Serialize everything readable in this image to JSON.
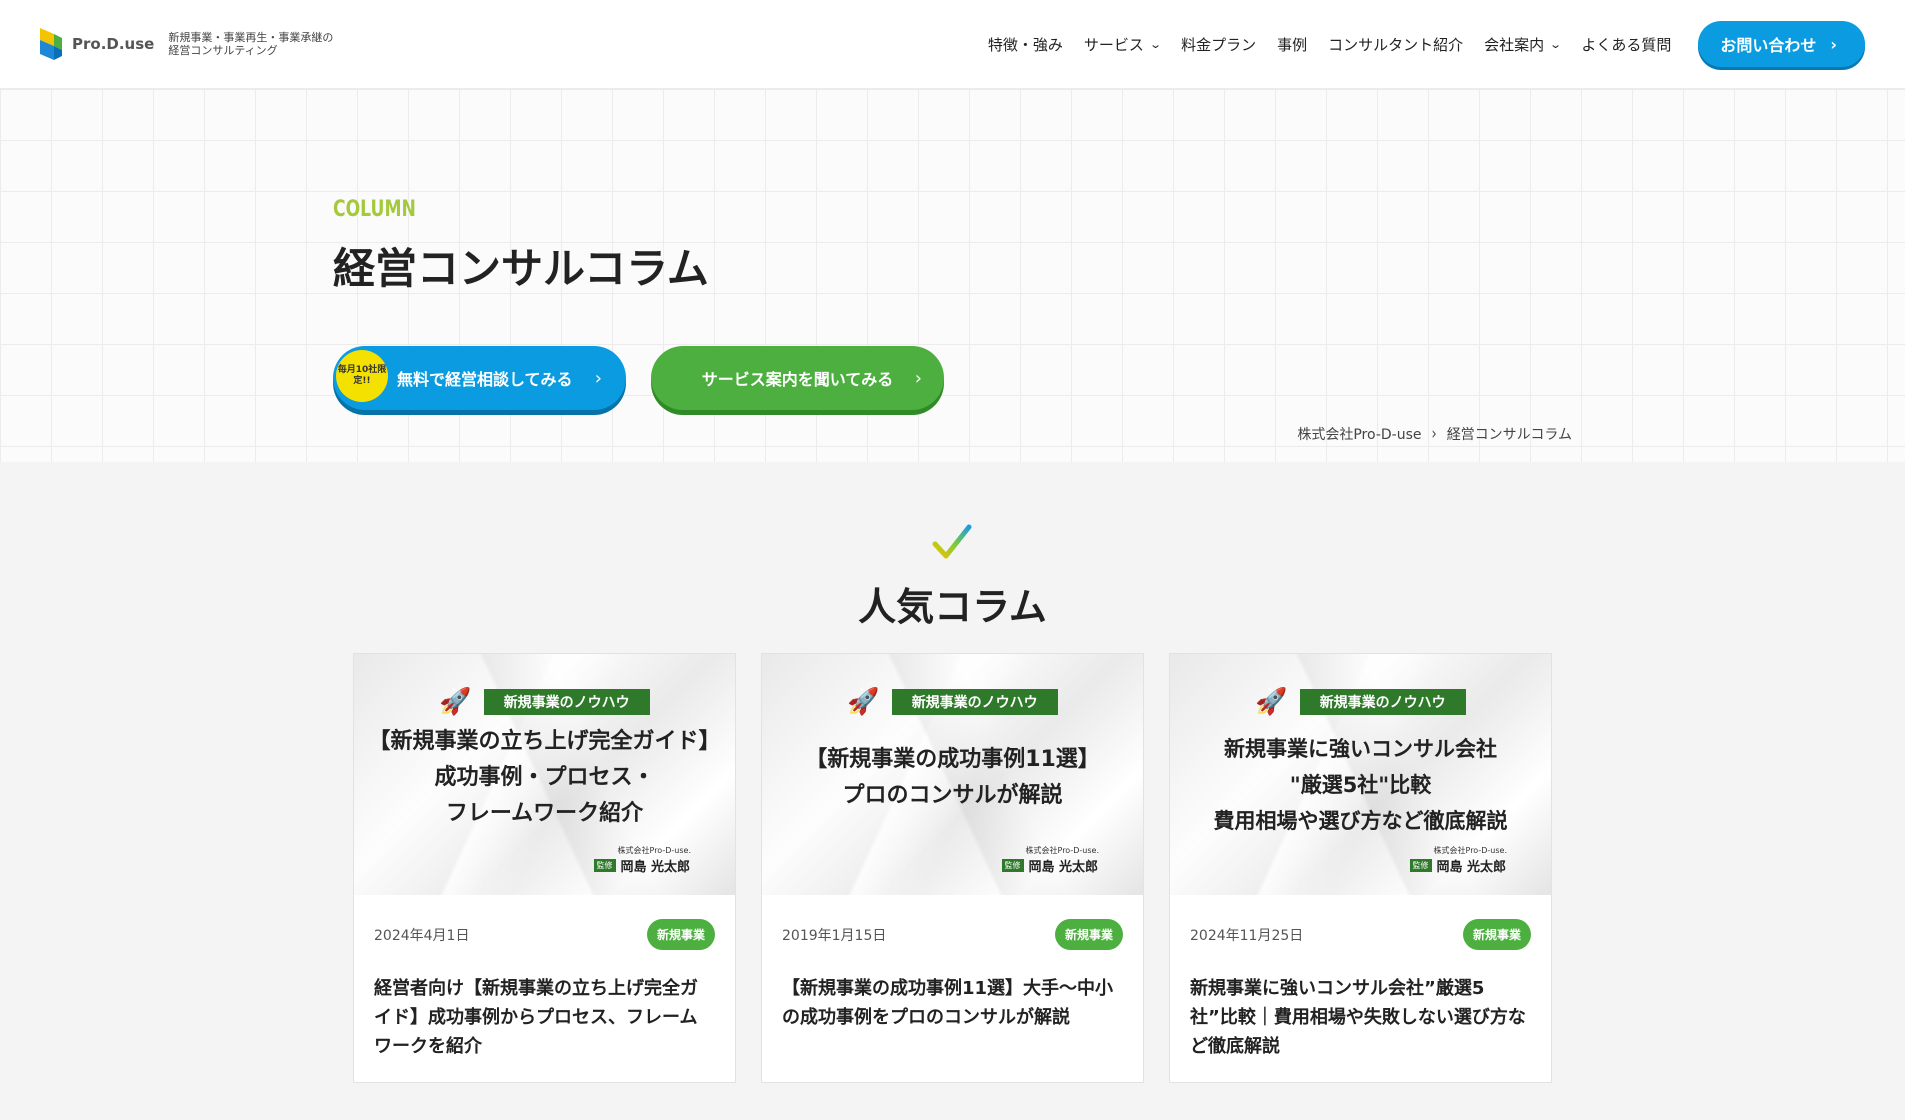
{
  "header": {
    "logo_word": "Pro.D.use",
    "tagline": "新規事業・事業再生・事業承継の経営コンサルティング",
    "nav": [
      {
        "label": "特徴・強み",
        "has_dropdown": false
      },
      {
        "label": "サービス",
        "has_dropdown": true
      },
      {
        "label": "料金プラン",
        "has_dropdown": false
      },
      {
        "label": "事例",
        "has_dropdown": false
      },
      {
        "label": "コンサルタント紹介",
        "has_dropdown": false
      },
      {
        "label": "会社案内",
        "has_dropdown": true
      },
      {
        "label": "よくある質問",
        "has_dropdown": false
      }
    ],
    "contact_label": "お問い合わせ"
  },
  "hero": {
    "eyebrow": "COLUMN",
    "title": "経営コンサルコラム",
    "cta_primary": {
      "badge": "毎月10社限定!!",
      "label": "無料で経営相談してみる"
    },
    "cta_secondary": {
      "label": "サービス案内を聞いてみる"
    },
    "breadcrumb": [
      "株式会社Pro-D-use",
      "経営コンサルコラム"
    ]
  },
  "popular": {
    "title": "人気コラム",
    "cards": [
      {
        "thumb_tag": "新規事業のノウハウ",
        "thumb_title": "【新規事業の立ち上げ完全ガイド】\n成功事例・プロセス・\nフレームワーク紹介",
        "supervisor_company": "株式会社Pro-D-use.",
        "supervisor_label": "監修",
        "supervisor_name": "岡島 光太郎",
        "date": "2024年4月1日",
        "category": "新規事業",
        "title": "経営者向け【新規事業の立ち上げ完全ガイド】成功事例からプロセス、フレームワークを紹介"
      },
      {
        "thumb_tag": "新規事業のノウハウ",
        "thumb_title": "【新規事業の成功事例11選】\nプロのコンサルが解説",
        "supervisor_company": "株式会社Pro-D-use.",
        "supervisor_label": "監修",
        "supervisor_name": "岡島 光太郎",
        "date": "2019年1月15日",
        "category": "新規事業",
        "title": "【新規事業の成功事例11選】大手〜中小の成功事例をプロのコンサルが解説"
      },
      {
        "thumb_tag": "新規事業のノウハウ",
        "thumb_title": "新規事業に強いコンサル会社\n\"厳選5社\"比較\n費用相場や選び方など徹底解説",
        "supervisor_company": "株式会社Pro-D-use.",
        "supervisor_label": "監修",
        "supervisor_name": "岡島 光太郎",
        "date": "2024年11月25日",
        "category": "新規事業",
        "title": "新規事業に強いコンサル会社”厳選5社”比較｜費用相場や失敗しない選び方など徹底解説"
      }
    ]
  },
  "colors": {
    "blue": "#0b9be0",
    "green": "#4caf3f",
    "dark_green": "#2f7a2a",
    "eyebrow": "#a5c93c",
    "badge_yellow": "#f5e100"
  },
  "icons": {
    "check": "check-mark-icon",
    "rocket": "rocket-icon",
    "chevron": "chevron-right-icon"
  }
}
